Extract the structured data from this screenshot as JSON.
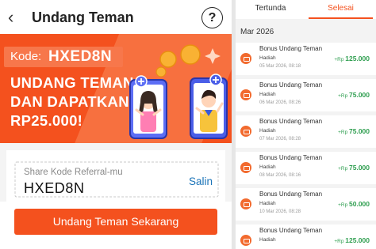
{
  "header": {
    "back": "‹",
    "title": "Undang Teman",
    "help": "?"
  },
  "banner": {
    "code_label": "Kode:",
    "code_value": "HXED8N",
    "headline": [
      "UNDANG TEMAN",
      "DAN DAPATKAN",
      "RP25.000!"
    ]
  },
  "share": {
    "label": "Share Kode Referral-mu",
    "code": "HXED8N",
    "copy_label": "Salin"
  },
  "cta_label": "Undang Teman Sekarang",
  "tabs": [
    {
      "label": "Tertunda"
    },
    {
      "label": "Selesai"
    }
  ],
  "colors": {
    "accent": "#f4511e",
    "positive": "#2e9e4f",
    "link": "#1a73b8"
  },
  "month": "Mar 2026",
  "transactions": [
    {
      "title": "Bonus Undang Teman",
      "subtitle": "Hadiah",
      "date": "05 Mar 2026, 08:18",
      "prefix": "+Rp",
      "amount": "125.000"
    },
    {
      "title": "Bonus Undang Teman",
      "subtitle": "Hadiah",
      "date": "06 Mar 2026, 08:26",
      "prefix": "+Rp",
      "amount": "75.000"
    },
    {
      "title": "Bonus Undang Teman",
      "subtitle": "Hadiah",
      "date": "07 Mar 2026, 08:28",
      "prefix": "+Rp",
      "amount": "75.000"
    },
    {
      "title": "Bonus Undang Teman",
      "subtitle": "Hadiah",
      "date": "08 Mar 2026, 08:16",
      "prefix": "+Rp",
      "amount": "75.000"
    },
    {
      "title": "Bonus Undang Teman",
      "subtitle": "Hadiah",
      "date": "10 Mar 2026, 08:28",
      "prefix": "+Rp",
      "amount": "50.000"
    },
    {
      "title": "Bonus Undang Teman",
      "subtitle": "Hadiah",
      "date": "",
      "prefix": "+Rp",
      "amount": "125.000"
    }
  ]
}
